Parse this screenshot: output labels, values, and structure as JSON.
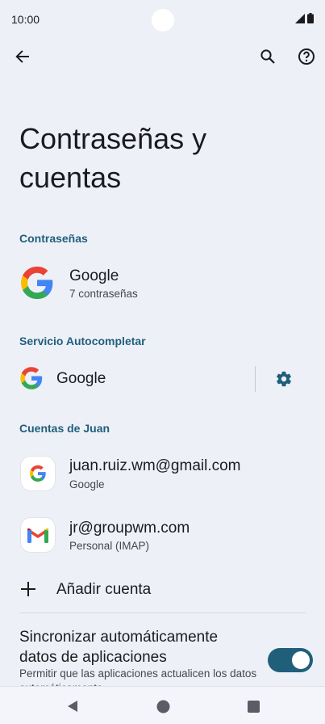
{
  "status_bar": {
    "time": "10:00"
  },
  "page": {
    "title": "Contraseñas y cuentas"
  },
  "passwords_section": {
    "header": "Contraseñas",
    "item": {
      "title": "Google",
      "subtitle": "7 contraseñas"
    }
  },
  "autofill_section": {
    "header": "Servicio Autocompletar",
    "item": {
      "title": "Google"
    }
  },
  "accounts_section": {
    "header": "Cuentas de Juan",
    "accounts": [
      {
        "title": "juan.ruiz.wm@gmail.com",
        "subtitle": "Google"
      },
      {
        "title": "jr@groupwm.com",
        "subtitle": "Personal (IMAP)"
      }
    ],
    "add_account_label": "Añadir cuenta"
  },
  "sync": {
    "title": "Sincronizar automáticamente datos de aplicaciones",
    "subtitle": "Permitir que las aplicaciones actualicen los datos automáticamente",
    "enabled": true
  },
  "colors": {
    "accent": "#1f5f7a",
    "background": "#eef0f8"
  }
}
